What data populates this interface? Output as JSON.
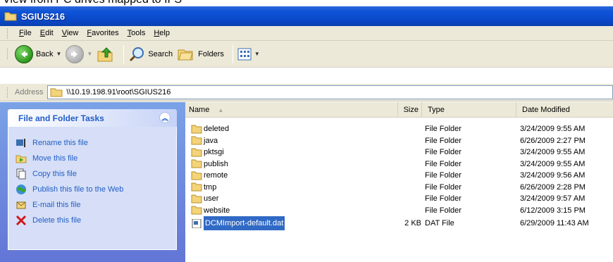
{
  "caption": "View from PC drives mapped to IFS",
  "window": {
    "title": "SGIUS216"
  },
  "menu": [
    "File",
    "Edit",
    "View",
    "Favorites",
    "Tools",
    "Help"
  ],
  "toolbar": {
    "back": "Back",
    "search": "Search",
    "folders": "Folders"
  },
  "address": {
    "label": "Address",
    "path": "\\\\10.19.198.91\\root\\SGIUS216"
  },
  "tasks": {
    "header": "File and Folder Tasks",
    "items": [
      {
        "label": "Rename this file",
        "icon": "rename-icon"
      },
      {
        "label": "Move this file",
        "icon": "move-icon"
      },
      {
        "label": "Copy this file",
        "icon": "copy-icon"
      },
      {
        "label": "Publish this file to the Web",
        "icon": "globe-icon"
      },
      {
        "label": "E-mail this file",
        "icon": "email-icon"
      },
      {
        "label": "Delete this file",
        "icon": "delete-icon"
      }
    ]
  },
  "columns": {
    "name": "Name",
    "size": "Size",
    "type": "Type",
    "date": "Date Modified"
  },
  "files": [
    {
      "name": "deleted",
      "size": "",
      "type": "File Folder",
      "date": "3/24/2009 9:55 AM"
    },
    {
      "name": "java",
      "size": "",
      "type": "File Folder",
      "date": "6/26/2009 2:27 PM"
    },
    {
      "name": "pktsgi",
      "size": "",
      "type": "File Folder",
      "date": "3/24/2009 9:55 AM"
    },
    {
      "name": "publish",
      "size": "",
      "type": "File Folder",
      "date": "3/24/2009 9:55 AM"
    },
    {
      "name": "remote",
      "size": "",
      "type": "File Folder",
      "date": "3/24/2009 9:56 AM"
    },
    {
      "name": "tmp",
      "size": "",
      "type": "File Folder",
      "date": "6/26/2009 2:28 PM"
    },
    {
      "name": "user",
      "size": "",
      "type": "File Folder",
      "date": "3/24/2009 9:57 AM"
    },
    {
      "name": "website",
      "size": "",
      "type": "File Folder",
      "date": "6/12/2009 3:15 PM"
    },
    {
      "name": "DCMImport-default.dat",
      "size": "2 KB",
      "type": "DAT File",
      "date": "6/29/2009 11:43 AM"
    }
  ],
  "colors": {
    "titlebar": "#0a48c8",
    "task_link": "#215dc6",
    "selection": "#316ac5",
    "left_pane": "#6375d6"
  }
}
